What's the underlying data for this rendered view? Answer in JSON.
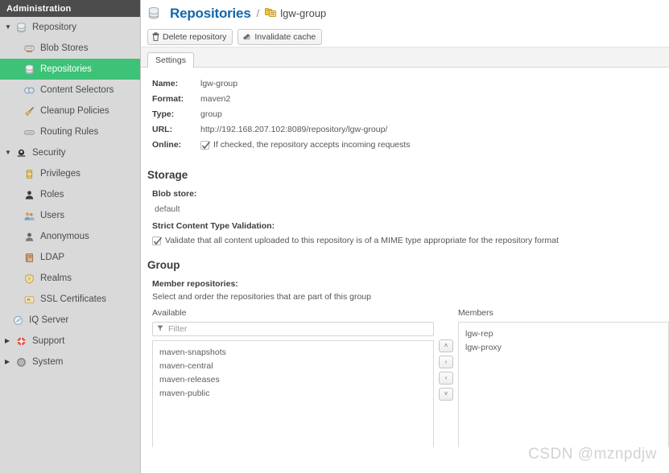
{
  "sidebar": {
    "header": "Administration",
    "items": [
      {
        "label": "Repository",
        "level": "group",
        "icon": "database-icon",
        "caret": "down",
        "selected": false
      },
      {
        "label": "Blob Stores",
        "level": "child",
        "icon": "blob-store-icon",
        "caret": "",
        "selected": false
      },
      {
        "label": "Repositories",
        "level": "child",
        "icon": "database-icon",
        "caret": "",
        "selected": true
      },
      {
        "label": "Content Selectors",
        "level": "child",
        "icon": "content-selector-icon",
        "caret": "",
        "selected": false
      },
      {
        "label": "Cleanup Policies",
        "level": "child",
        "icon": "broom-icon",
        "caret": "",
        "selected": false
      },
      {
        "label": "Routing Rules",
        "level": "child",
        "icon": "routing-rules-icon",
        "caret": "",
        "selected": false
      },
      {
        "label": "Security",
        "level": "group",
        "icon": "security-icon",
        "caret": "down",
        "selected": false
      },
      {
        "label": "Privileges",
        "level": "child",
        "icon": "privileges-icon",
        "caret": "",
        "selected": false
      },
      {
        "label": "Roles",
        "level": "child",
        "icon": "roles-icon",
        "caret": "",
        "selected": false
      },
      {
        "label": "Users",
        "level": "child",
        "icon": "users-icon",
        "caret": "",
        "selected": false
      },
      {
        "label": "Anonymous",
        "level": "child",
        "icon": "anonymous-user-icon",
        "caret": "",
        "selected": false
      },
      {
        "label": "LDAP",
        "level": "child",
        "icon": "ldap-book-icon",
        "caret": "",
        "selected": false
      },
      {
        "label": "Realms",
        "level": "child",
        "icon": "shield-icon",
        "caret": "",
        "selected": false
      },
      {
        "label": "SSL Certificates",
        "level": "child",
        "icon": "certificate-icon",
        "caret": "",
        "selected": false
      },
      {
        "label": "IQ Server",
        "level": "subgroup",
        "icon": "iq-server-icon",
        "caret": "",
        "selected": false
      },
      {
        "label": "Support",
        "level": "group",
        "icon": "lifebuoy-icon",
        "caret": "right",
        "selected": false
      },
      {
        "label": "System",
        "level": "group",
        "icon": "gear-icon",
        "caret": "right",
        "selected": false
      }
    ]
  },
  "header": {
    "title": "Repositories",
    "title_icon": "database-icon",
    "separator": "/",
    "crumb_icon": "repository-group-icon",
    "crumb_name": "lgw-group"
  },
  "toolbar": {
    "buttons": [
      {
        "label": "Delete repository",
        "icon": "trash-icon"
      },
      {
        "label": "Invalidate cache",
        "icon": "eraser-icon"
      }
    ]
  },
  "tabs": [
    {
      "label": "Settings",
      "active": true
    }
  ],
  "settings": {
    "fields": [
      {
        "key": "Name:",
        "value": "lgw-group"
      },
      {
        "key": "Format:",
        "value": "maven2"
      },
      {
        "key": "Type:",
        "value": "group"
      },
      {
        "key": "URL:",
        "value": "http://192.168.207.102:8089/repository/lgw-group/"
      }
    ],
    "online": {
      "key": "Online:",
      "checked": true,
      "label": "If checked, the repository accepts incoming requests"
    }
  },
  "storage": {
    "title": "Storage",
    "blob_store_label": "Blob store:",
    "blob_store_value": "default",
    "strict_label": "Strict Content Type Validation:",
    "strict_checked": true,
    "strict_text": "Validate that all content uploaded to this repository is of a MIME type appropriate for the repository format"
  },
  "group": {
    "title": "Group",
    "member_label": "Member repositories:",
    "member_hint": "Select and order the repositories that are part of this group",
    "available_label": "Available",
    "members_label": "Members",
    "filter_placeholder": "Filter",
    "filter_value": "",
    "filter_icon": "funnel-icon",
    "available": [
      "maven-snapshots",
      "maven-central",
      "maven-releases",
      "maven-public"
    ],
    "members": [
      "lgw-rep",
      "lgw-proxy"
    ],
    "transfer_buttons": [
      {
        "glyph": "˄",
        "name": "move-up-button"
      },
      {
        "glyph": "›",
        "name": "add-to-members-button"
      },
      {
        "glyph": "‹",
        "name": "remove-from-members-button"
      },
      {
        "glyph": "˅",
        "name": "move-down-button"
      }
    ]
  },
  "watermark": "CSDN @mznpdjw",
  "colors": {
    "accent_green": "#3ec278",
    "title_blue": "#1267ad",
    "sidebar_bg": "#d9d9d9",
    "sidebar_header_bg": "#4c4c4c"
  }
}
